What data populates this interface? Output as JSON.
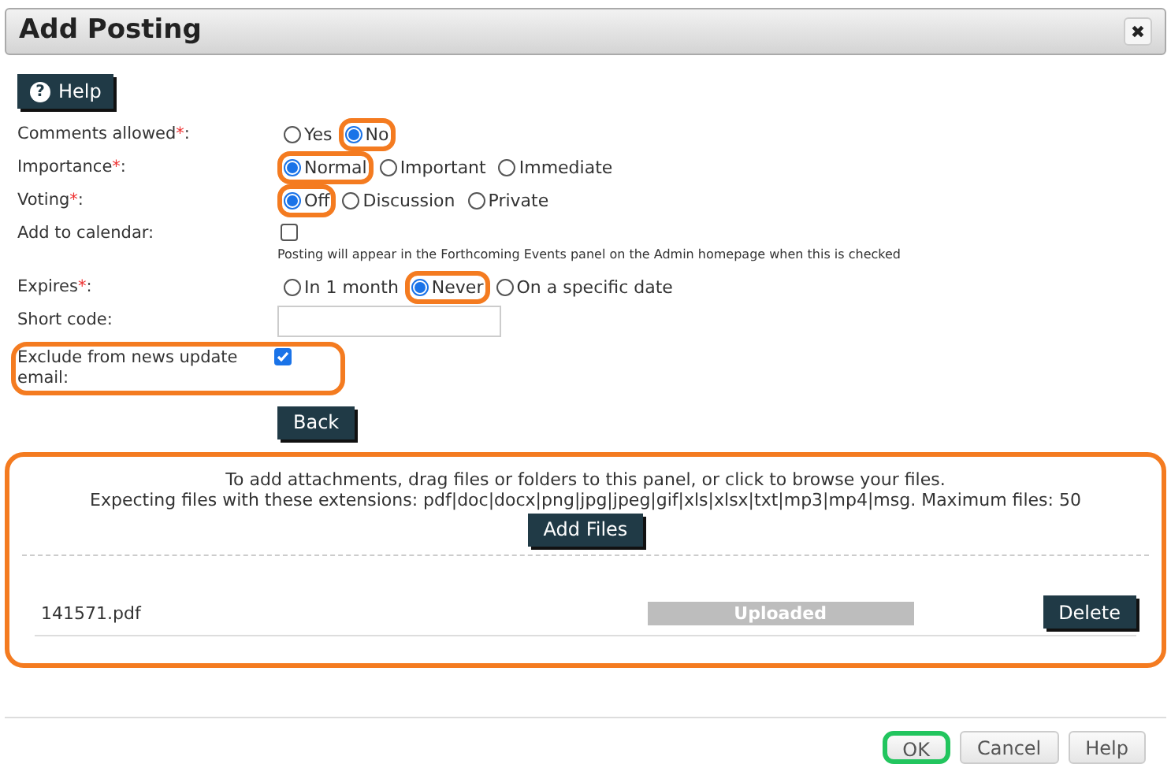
{
  "dialog": {
    "title": "Add Posting",
    "close_icon": "✖"
  },
  "help_button": {
    "label": "Help",
    "icon": "?"
  },
  "form": [
    {
      "kind": "radio",
      "label": "Comments allowed",
      "required_mark": "*",
      "label_end": ":",
      "highlighted": false,
      "options": [
        {
          "label": "Yes",
          "selected": false,
          "highlighted": false
        },
        {
          "label": "No",
          "selected": true,
          "highlighted": true
        }
      ]
    },
    {
      "kind": "radio",
      "label": "Importance",
      "required_mark": "*",
      "label_end": ":",
      "highlighted": false,
      "options": [
        {
          "label": "Normal",
          "selected": true,
          "highlighted": true
        },
        {
          "label": "Important",
          "selected": false,
          "highlighted": false
        },
        {
          "label": "Immediate",
          "selected": false,
          "highlighted": false
        }
      ]
    },
    {
      "kind": "radio",
      "label": "Voting",
      "required_mark": "*",
      "label_end": ":",
      "highlighted": false,
      "options": [
        {
          "label": "Off",
          "selected": true,
          "highlighted": true
        },
        {
          "label": "Discussion",
          "selected": false,
          "highlighted": false
        },
        {
          "label": "Private",
          "selected": false,
          "highlighted": false
        }
      ]
    },
    {
      "kind": "checkbox",
      "label": "Add to calendar",
      "label_end": ":",
      "highlighted": false,
      "checked": false,
      "note": "Posting will appear in the Forthcoming Events panel on the Admin homepage when this is checked"
    },
    {
      "kind": "radio",
      "label": "Expires",
      "required_mark": "*",
      "label_end": ":",
      "highlighted": false,
      "options": [
        {
          "label": "In 1 month",
          "selected": false,
          "highlighted": false
        },
        {
          "label": "Never",
          "selected": true,
          "highlighted": true
        },
        {
          "label": "On a specific date",
          "selected": false,
          "highlighted": false
        }
      ]
    },
    {
      "kind": "text",
      "label": "Short code",
      "label_end": ":",
      "highlighted": false
    },
    {
      "kind": "checkbox",
      "label": "Exclude from news update email",
      "label_end": ":",
      "highlighted": true,
      "checked": true
    }
  ],
  "back_button": "Back",
  "upload": {
    "highlighted": true,
    "instructions": "To add attachments, drag files or folders to this panel, or click to browse your files.",
    "extensions": "Expecting files with these extensions: pdf|doc|docx|png|jpg|jpeg|gif|xls|xlsx|txt|mp3|mp4|msg. Maximum files: 50",
    "add_button": "Add Files",
    "files": [
      {
        "name": "141571.pdf",
        "status": "Uploaded",
        "level": 1,
        "delete_label": "Delete"
      }
    ]
  },
  "buttons": [
    {
      "label": "OK",
      "highlighted": true
    },
    {
      "label": "Cancel",
      "highlighted": false
    },
    {
      "label": "Help",
      "highlighted": false
    }
  ]
}
